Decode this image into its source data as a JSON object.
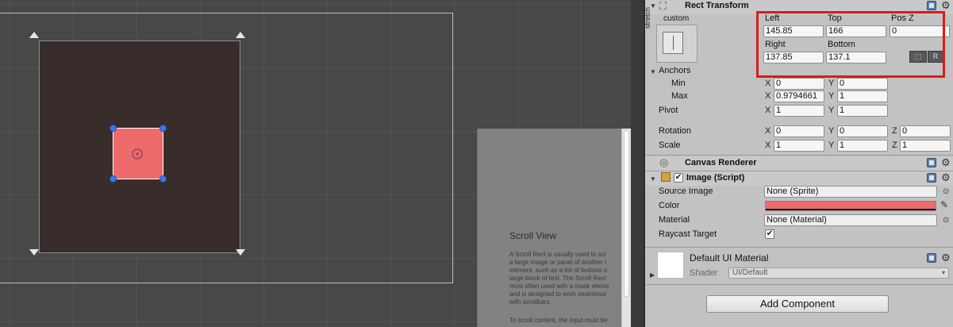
{
  "scene": {
    "tooltip": {
      "title": "Scroll View",
      "body": "A Scroll Rect is usually used to scr\na large image or panel of another l\nelement, such as a list of buttons o\nlarge block of text. The Scroll Rect\nmost often used with a mask eleme\nand is designed to work seamlessl\nwith scrollbars.",
      "body2": "To scroll content, the input must be"
    }
  },
  "rect_transform": {
    "title": "Rect Transform",
    "anchor_preset": "custom",
    "stretch_label": "stretch",
    "left_label": "Left",
    "left": "145.85",
    "top_label": "Top",
    "top": "166",
    "posz_label": "Pos Z",
    "posz": "0",
    "right_label": "Right",
    "right": "137.85",
    "bottom_label": "Bottom",
    "bottom": "137.1",
    "raw_btn": "R",
    "anchors_label": "Anchors",
    "min_label": "Min",
    "min_x": "0",
    "min_y": "0",
    "max_label": "Max",
    "max_x": "0.9794661",
    "max_y": "1",
    "pivot_label": "Pivot",
    "pivot_x": "1",
    "pivot_y": "1",
    "rotation_label": "Rotation",
    "rot_x": "0",
    "rot_y": "0",
    "rot_z": "0",
    "scale_label": "Scale",
    "scale_x": "1",
    "scale_y": "1",
    "scale_z": "1",
    "x": "X",
    "y": "Y",
    "z": "Z"
  },
  "canvas_renderer": {
    "title": "Canvas Renderer"
  },
  "image_script": {
    "title": "Image (Script)",
    "source_image_label": "Source Image",
    "source_image": "None (Sprite)",
    "color_label": "Color",
    "color": "#ee6b6b",
    "material_label": "Material",
    "material": "None (Material)",
    "raycast_label": "Raycast Target",
    "raycast": true
  },
  "material_section": {
    "name": "Default UI Material",
    "shader_label": "Shader",
    "shader": "UI/Default"
  },
  "add_component": "Add Component"
}
